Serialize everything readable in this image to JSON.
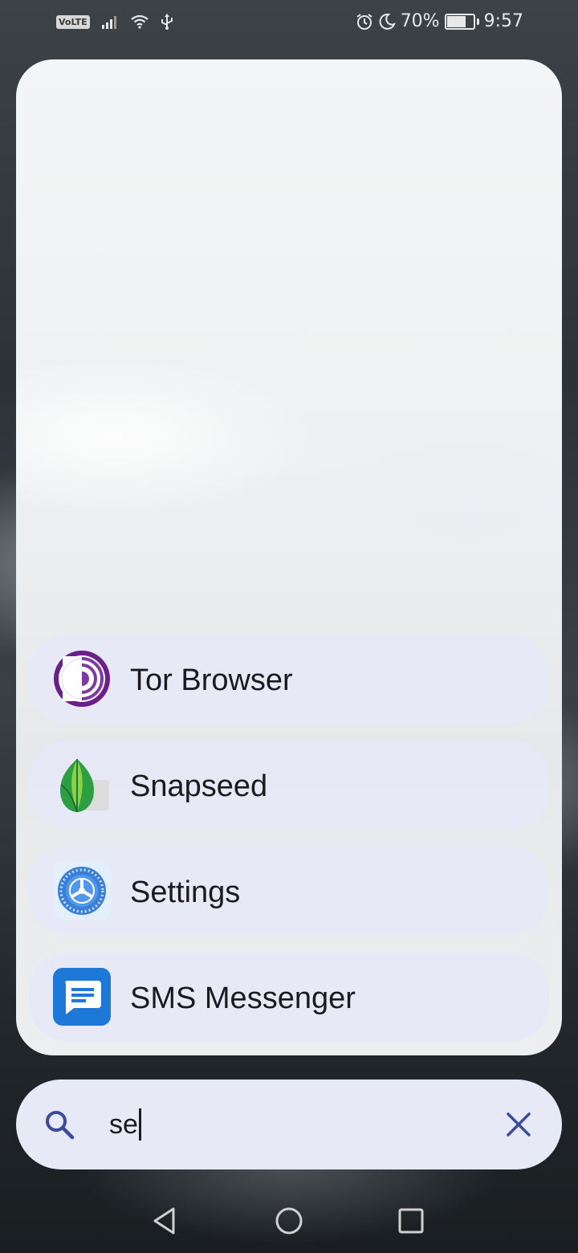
{
  "status_bar": {
    "volte_label": "VoLTE",
    "battery_percent_text": "70%",
    "battery_level": 0.7,
    "time": "9:57",
    "icons": [
      "volte-icon",
      "signal-icon",
      "wifi-icon",
      "usb-icon",
      "alarm-icon",
      "do-not-disturb-moon-icon",
      "battery-icon"
    ]
  },
  "results": [
    {
      "label": "Tor Browser",
      "icon": "tor-browser-icon"
    },
    {
      "label": "Snapseed",
      "icon": "snapseed-icon"
    },
    {
      "label": "Settings",
      "icon": "settings-icon"
    },
    {
      "label": "SMS Messenger",
      "icon": "sms-messenger-icon"
    }
  ],
  "search": {
    "value": "se",
    "icon": "search-icon",
    "clear_icon": "close-icon",
    "accent_color": "#3c4a9c"
  },
  "nav_bar": {
    "buttons": [
      "back-icon",
      "home-icon",
      "recents-icon"
    ]
  }
}
